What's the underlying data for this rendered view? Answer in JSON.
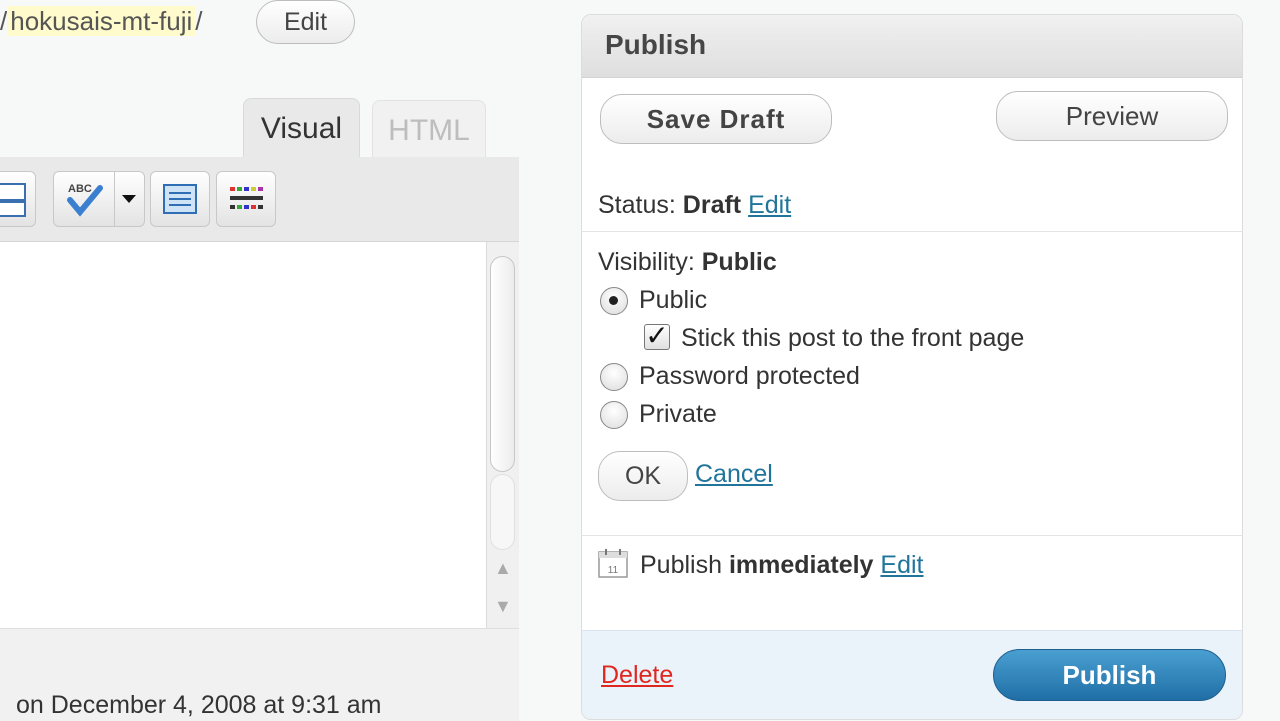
{
  "permalink": {
    "prefix": "/",
    "slug": "hokusais-mt-fuji",
    "suffix": "/",
    "edit_label": "Edit"
  },
  "editor": {
    "tabs": {
      "visual": "Visual",
      "html": "HTML"
    },
    "toolbar_icons": [
      "insert-icon",
      "spellcheck-icon",
      "dropdown-arrow-icon",
      "fullscreen-icon",
      "kitchen-sink-icon"
    ],
    "footer_text": "on December 4, 2008 at 9:31 am"
  },
  "publish": {
    "title": "Publish",
    "save_draft_label": "Save Draft",
    "preview_label": "Preview",
    "status": {
      "label": "Status:",
      "value": "Draft",
      "edit": "Edit"
    },
    "visibility": {
      "label": "Visibility:",
      "value": "Public",
      "options": [
        {
          "label": "Public",
          "checked": true
        },
        {
          "label": "Password protected",
          "checked": false
        },
        {
          "label": "Private",
          "checked": false
        }
      ],
      "sticky_label": "Stick this post to the front page",
      "sticky_checked": true,
      "ok_label": "OK",
      "cancel_label": "Cancel"
    },
    "schedule": {
      "icon": "calendar-icon",
      "calendar_day": "11",
      "label": "Publish",
      "value": "immediately",
      "edit": "Edit"
    },
    "delete_label": "Delete",
    "publish_label": "Publish"
  },
  "colors": {
    "link": "#21759b",
    "delete": "#e0261f",
    "publish_button": "#2e86bf",
    "slug_highlight": "#fffbcc"
  }
}
